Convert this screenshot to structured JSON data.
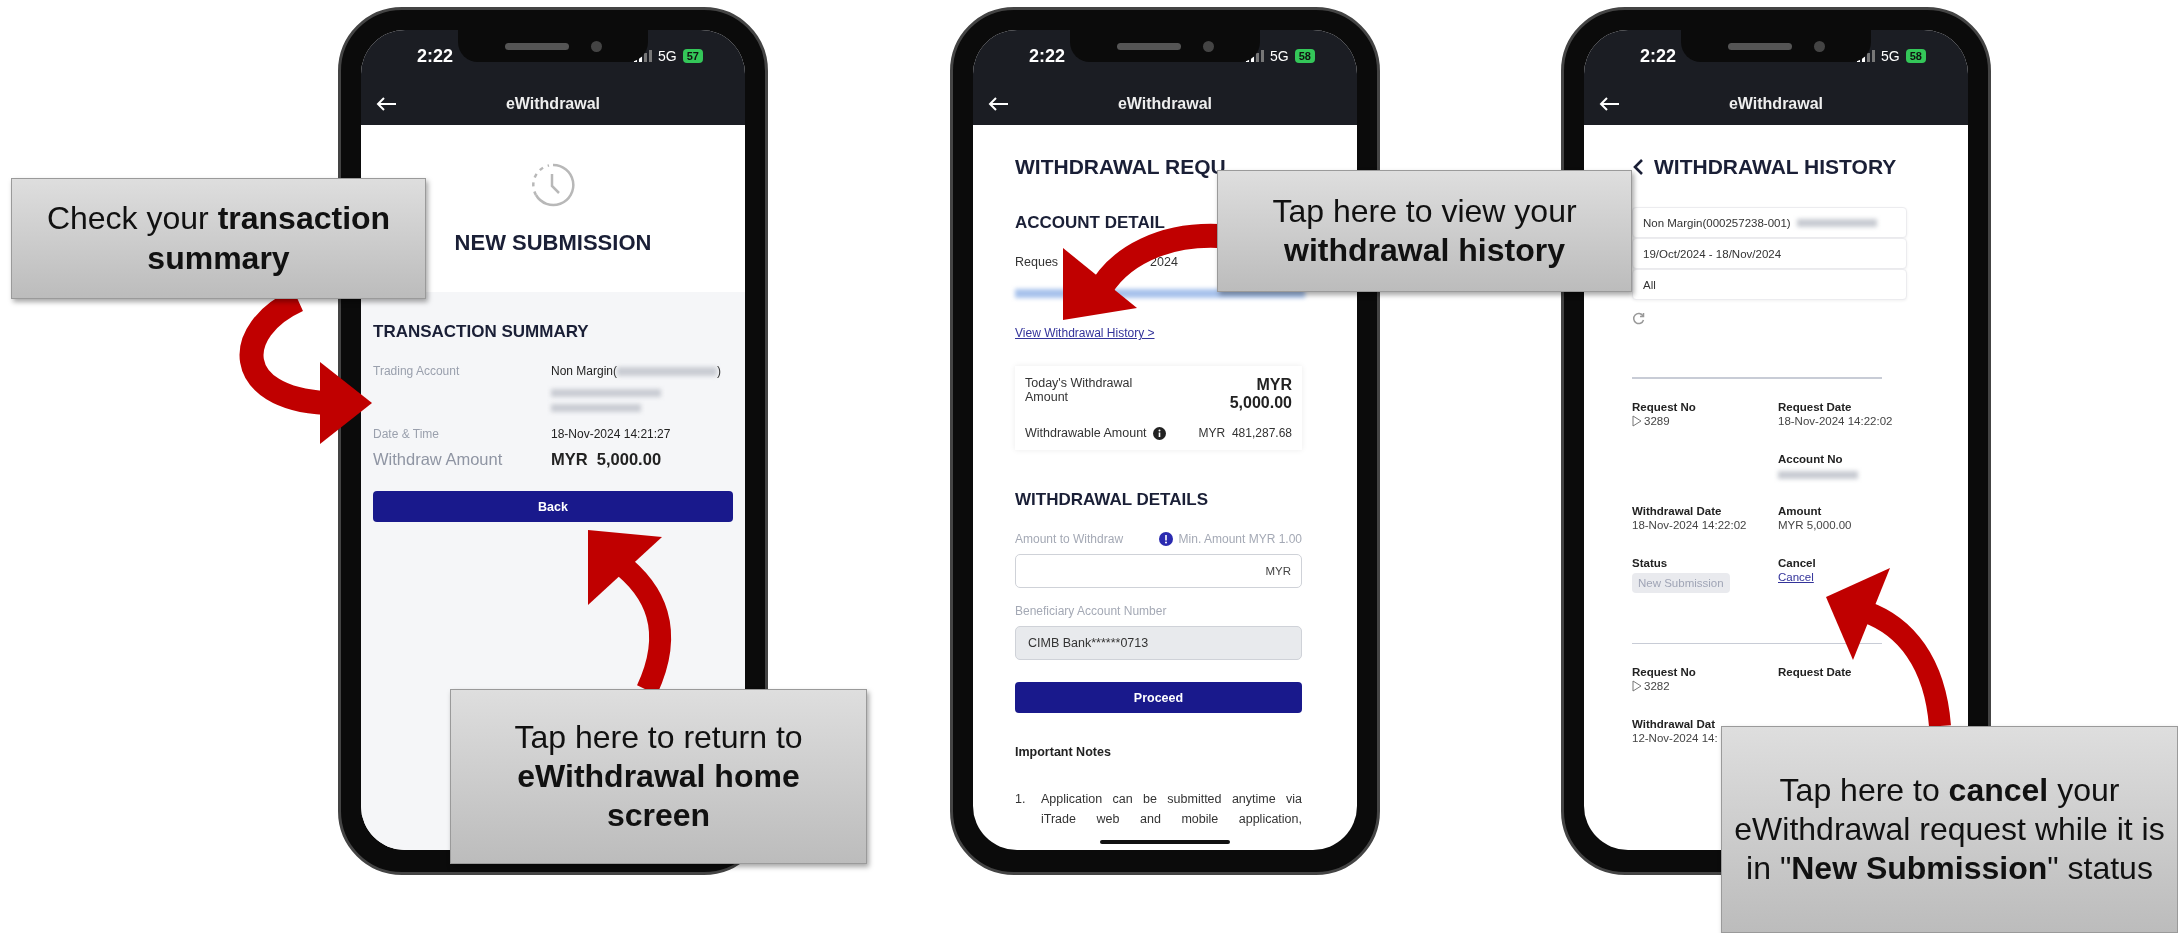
{
  "phones": [
    {
      "kind": "submission",
      "status_time": "2:22",
      "network": "5G",
      "battery": "57",
      "title": "eWithdrawal",
      "heading": "NEW SUBMISSION",
      "section_title": "TRANSACTION SUMMARY",
      "rows": [
        {
          "label": "Trading Account",
          "value": "Non Margin(",
          "value_end": ")",
          "emphasis": false
        },
        {
          "label": "Date & Time",
          "value": "18-Nov-2024 14:21:27",
          "emphasis": false
        },
        {
          "label": "Withdraw Amount",
          "value": "MYR  5,000.00",
          "emphasis": true
        }
      ],
      "button": "Back"
    },
    {
      "kind": "request",
      "status_time": "2:22",
      "network": "5G",
      "battery": "58",
      "title": "eWithdrawal",
      "heading": "WITHDRAWAL REQU",
      "section_title": "ACCOUNT DETAIL",
      "request_date_start": "Reques",
      "request_date_end": "2024",
      "history_link": "View Withdrawal History >",
      "today_label": "Today's Withdrawal Amount",
      "today_currency": "MYR",
      "today_amount": "5,000.00",
      "withdrawable_label": "Withdrawable Amount",
      "withdrawable_value": "MYR  481,287.68",
      "details_title": "WITHDRAWAL DETAILS",
      "amount_label": "Amount to Withdraw",
      "min_note": "Min. Amount MYR 1.00",
      "amount_suffix": "MYR",
      "beneficiary_label": "Beneficiary Account Number",
      "beneficiary_field": {
        "value": "CIMB Bank******0713",
        "disabled": true
      },
      "button": "Proceed",
      "notes_title": "Important Notes",
      "notes": [
        {
          "number": "1.",
          "text": "Application can be submitted anytime via iTrade web and mobile application,"
        }
      ]
    },
    {
      "kind": "history",
      "status_time": "2:22",
      "network": "5G",
      "battery": "58",
      "title": "eWithdrawal",
      "heading": "WITHDRAWAL HISTORY",
      "filters": [
        {
          "value": "Non Margin(000257238-001)",
          "redacted": true
        },
        {
          "value": "19/Oct/2024 - 18/Nov/2024",
          "redacted": false
        },
        {
          "value": "All",
          "redacted": false
        }
      ],
      "records": [
        {
          "fields": [
            {
              "kind": "request_no",
              "label": "Request No",
              "value": "3289"
            },
            {
              "kind": "text",
              "label": "Request Date",
              "value": "18-Nov-2024 14:22:02"
            },
            {
              "kind": "empty"
            },
            {
              "kind": "redacted",
              "label": "Account No"
            },
            {
              "kind": "text",
              "label": "Withdrawal Date",
              "value": "18-Nov-2024 14:22:02"
            },
            {
              "kind": "text",
              "label": "Amount",
              "value": "MYR 5,000.00"
            },
            {
              "kind": "status",
              "label": "Status",
              "value": "New Submission"
            },
            {
              "kind": "link",
              "label": "Cancel",
              "value": "Cancel"
            }
          ]
        },
        {
          "fields": [
            {
              "kind": "request_no",
              "label": "Request No",
              "value": "3282"
            },
            {
              "kind": "text",
              "label": "Request Date"
            },
            {
              "kind": "text",
              "label": "Withdrawal Dat",
              "value": "12-Nov-2024 14:"
            }
          ]
        }
      ]
    }
  ],
  "callouts": [
    {
      "text": "Check your **transaction summary**"
    },
    {
      "text": "Tap here to return to **eWithdrawal home screen**"
    },
    {
      "text": "Tap here to view your **withdrawal history**"
    },
    {
      "text": "Tap here to **cancel** your eWithdrawal request while it is in \"**New Submission**\" status"
    }
  ]
}
